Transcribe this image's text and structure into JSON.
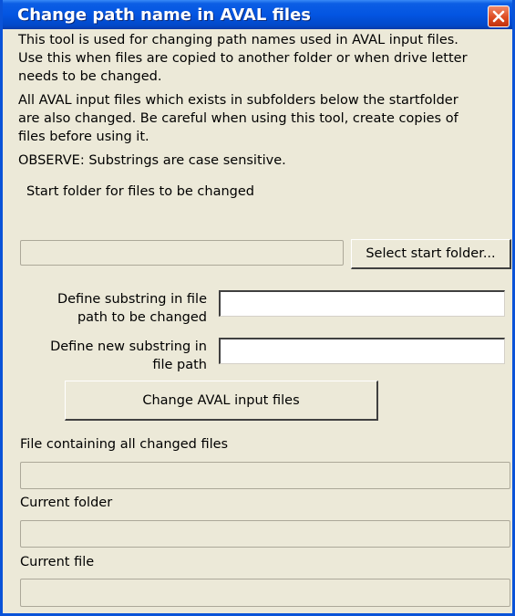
{
  "window": {
    "title": "Change path name in AVAL files"
  },
  "description": {
    "paragraph1": [
      "This tool is used for changing path names used in AVAL input files.",
      "Use this when files are copied to another folder or when drive letter",
      "needs to be changed."
    ],
    "paragraph2": [
      "All AVAL input files which exists in subfolders below the startfolder",
      "are also changed. Be careful when using this tool, create copies of",
      "files before using it."
    ],
    "observe": "OBSERVE: Substrings are case sensitive."
  },
  "start_folder": {
    "label": "Start folder for files to be changed",
    "value": "",
    "button_label": "Select start folder..."
  },
  "substring": {
    "label_line1": "Define substring in file",
    "label_line2": "path to be changed",
    "value": ""
  },
  "new_substring": {
    "label_line1": "Define new substring in",
    "label_line2": "file path",
    "value": ""
  },
  "change_button": {
    "label": "Change AVAL input files"
  },
  "changed_files": {
    "label": "File containing all changed files",
    "value": ""
  },
  "current_folder": {
    "label": "Current folder",
    "value": ""
  },
  "current_file": {
    "label": "Current file",
    "value": ""
  }
}
